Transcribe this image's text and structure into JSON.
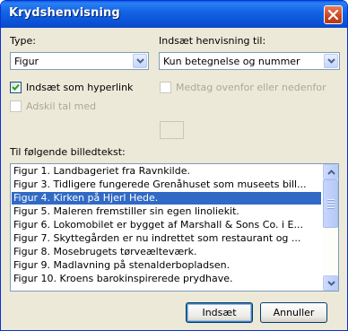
{
  "window": {
    "title": "Krydshenvisning"
  },
  "type_field": {
    "label": "Type:",
    "value": "Figur"
  },
  "reference_field": {
    "label": "Indsæt henvisning til:",
    "value": "Kun betegnelse og nummer"
  },
  "options": {
    "hyperlink": {
      "label": "Indsæt som hyperlink",
      "checked": true
    },
    "above_below": {
      "label": "Medtag ovenfor eller nedenfor",
      "checked": false,
      "enabled": false
    },
    "separate_numbers": {
      "label": "Adskil tal med",
      "checked": false,
      "enabled": false
    }
  },
  "list": {
    "label": "Til følgende billedtekst:",
    "items": [
      "Figur 1. Landbageriet fra Ravnkilde.",
      "Figur 3. Tidligere fungerede Grenåhuset som museets bill...",
      "Figur 4. Kirken på Hjerl Hede.",
      "Figur 5. Maleren fremstiller sin egen linoliekit.",
      "Figur 6. Lokomobilet er bygget af Marshall & Sons Co. i E...",
      "Figur 7. Skyttegården er nu indrettet som restaurant og ...",
      "Figur 8. Mosebrugets tørveælteværk.",
      "Figur 9. Madlavning på stenalderbopladsen.",
      "Figur 10. Kroens barokinspirerede prydhave."
    ],
    "selected_index": 2
  },
  "buttons": {
    "insert": "Indsæt",
    "cancel": "Annuller"
  },
  "colors": {
    "titlebar": "#0a52d6",
    "selection": "#316ac5",
    "dialog_bg": "#ece9d8"
  }
}
